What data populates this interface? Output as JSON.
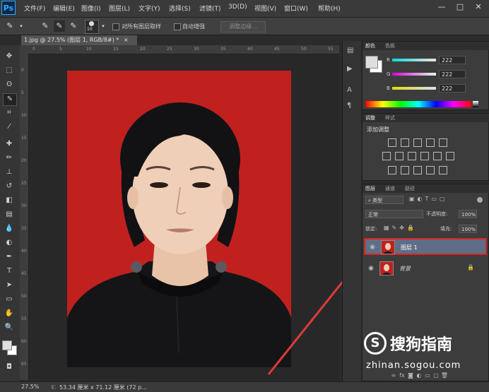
{
  "app": {
    "logo": "Ps"
  },
  "menu": [
    "文件(F)",
    "编辑(E)",
    "图像(I)",
    "图层(L)",
    "文字(Y)",
    "选择(S)",
    "滤镜(T)",
    "3D(D)",
    "视图(V)",
    "窗口(W)",
    "帮助(H)"
  ],
  "window_controls": {
    "minimize": "—",
    "maximize": "□",
    "close": "✕"
  },
  "options_bar": {
    "brush_size": "10",
    "sample_all_label": "对所有图层取样",
    "auto_enhance_label": "自动增强",
    "refine_edge_label": "调整边缘..."
  },
  "document": {
    "tab_title": "1.jpg @ 27.5% (图层 1, RGB/8#) *",
    "tab_close": "×"
  },
  "ruler_top": [
    "0",
    "5",
    "10",
    "15",
    "20",
    "25",
    "30",
    "35",
    "40",
    "45",
    "50",
    "55"
  ],
  "ruler_left": [
    "0",
    "5",
    "10",
    "15",
    "20",
    "25",
    "30",
    "35",
    "40",
    "45",
    "50",
    "55",
    "60",
    "65"
  ],
  "color_panel": {
    "tabs": [
      "颜色",
      "色板"
    ],
    "channels": [
      {
        "label": "R",
        "value": "222"
      },
      {
        "label": "G",
        "value": "222"
      },
      {
        "label": "B",
        "value": "222"
      }
    ]
  },
  "adjust_panel": {
    "tabs": [
      "调整",
      "样式"
    ],
    "title": "添加调整"
  },
  "layers_panel": {
    "tabs": [
      "图层",
      "通道",
      "路径"
    ],
    "kind_filter": "类型",
    "blend_mode": "正常",
    "opacity_label": "不透明度:",
    "opacity_value": "100%",
    "lock_label": "锁定:",
    "fill_label": "填充:",
    "fill_value": "100%",
    "layers": [
      {
        "name": "图层 1",
        "selected": true
      },
      {
        "name": "背景",
        "selected": false,
        "locked": true
      }
    ]
  },
  "status": {
    "zoom": "27.5%",
    "doc_info": "53.34 厘米 x 71.12 厘米 (72 p..."
  },
  "watermark": {
    "text": "搜狗指南",
    "url": "zhinan.sogou.com"
  },
  "colors": {
    "photo_background": "#c0211f",
    "annotation": "#e03a3a",
    "selection_highlight": "#e02020"
  }
}
